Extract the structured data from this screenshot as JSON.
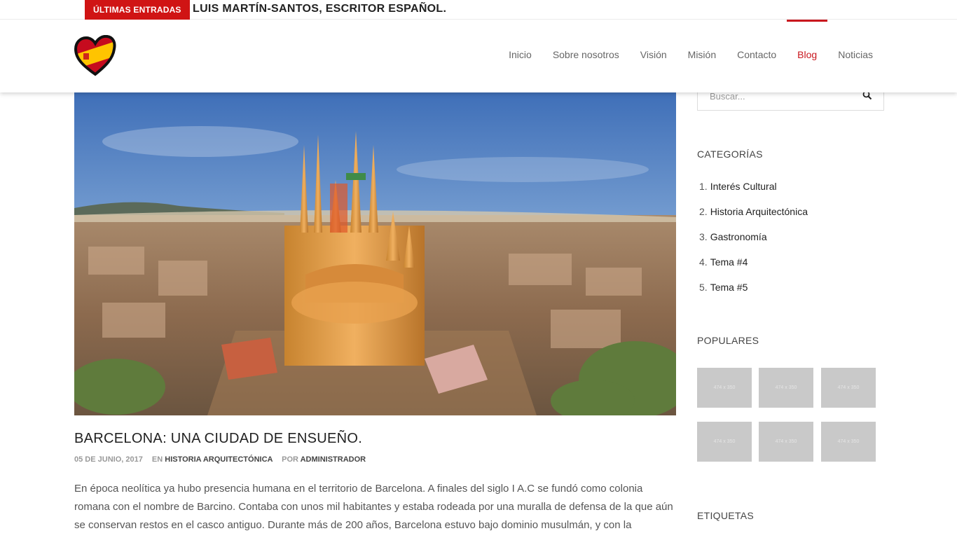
{
  "ticker": {
    "badge": "ÚLTIMAS ENTRADAS",
    "headline": "LUIS MARTÍN-SANTOS, ESCRITOR ESPAÑOL."
  },
  "nav": {
    "items": [
      {
        "label": "Inicio",
        "active": false
      },
      {
        "label": "Sobre nosotros",
        "active": false
      },
      {
        "label": "Visión",
        "active": false
      },
      {
        "label": "Misión",
        "active": false
      },
      {
        "label": "Contacto",
        "active": false
      },
      {
        "label": "Blog",
        "active": true
      },
      {
        "label": "Noticias",
        "active": false
      }
    ]
  },
  "logo": {
    "icon": "spain-heart-logo"
  },
  "post": {
    "title": "BARCELONA: UNA CIUDAD DE ENSUEÑO.",
    "date": "05 DE JUNIO, 2017",
    "in_label": "EN",
    "category": "HISTORIA ARQUITECTÓNICA",
    "by_label": "POR",
    "author": "ADMINISTRADOR",
    "body": "En época neolítica ya hubo presencia humana en el territorio de Barcelona. A finales del siglo I A.C se fundó como colonia romana con el nombre de Barcino. Contaba con unos mil habitantes y estaba rodeada por una muralla de defensa de la que aún se conservan restos en el casco antiguo. Durante más de 200 años, Barcelona estuvo bajo dominio musulmán, y con la"
  },
  "sidebar": {
    "search": {
      "placeholder": "Buscar..."
    },
    "categories_title": "CATEGORÍAS",
    "categories": [
      {
        "num": "1.",
        "label": "Interés Cultural"
      },
      {
        "num": "2.",
        "label": "Historia Arquitectónica"
      },
      {
        "num": "3.",
        "label": "Gastronomía"
      },
      {
        "num": "4.",
        "label": "Tema #4"
      },
      {
        "num": "5.",
        "label": "Tema #5"
      }
    ],
    "popular_title": "POPULARES",
    "popular_thumbs": [
      "474 x 350",
      "474 x 350",
      "474 x 350",
      "474 x 350",
      "474 x 350",
      "474 x 350"
    ],
    "tags_title": "ETIQUETAS"
  },
  "colors": {
    "accent": "#c9171e",
    "badge": "#d01414"
  }
}
